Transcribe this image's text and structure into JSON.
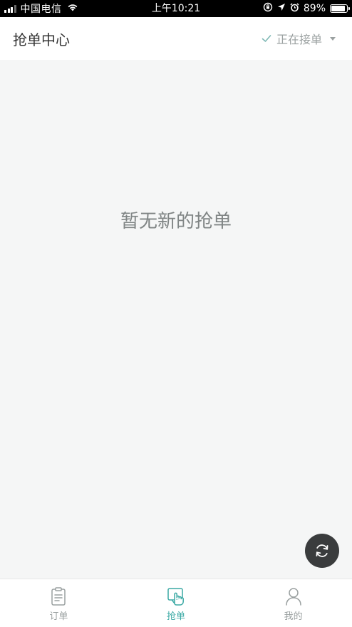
{
  "status_bar": {
    "carrier": "中国电信",
    "time": "上午10:21",
    "battery_percent": "89%",
    "battery_level": 0.89,
    "icons": [
      "signal-icon",
      "wifi-icon",
      "lock-rotation-icon",
      "location-icon",
      "alarm-icon",
      "battery-icon"
    ]
  },
  "header": {
    "title": "抢单中心",
    "status_label": "正在接单",
    "icons": [
      "check-icon",
      "caret-down-icon"
    ]
  },
  "main": {
    "empty_message": "暂无新的抢单",
    "fab_icon": "refresh-icon"
  },
  "tabbar": {
    "tabs": [
      {
        "label": "订单",
        "icon": "clipboard-icon",
        "active": false
      },
      {
        "label": "抢单",
        "icon": "tap-hand-icon",
        "active": true
      },
      {
        "label": "我的",
        "icon": "user-icon",
        "active": false
      }
    ]
  },
  "colors": {
    "accent": "#3aa9a4",
    "inactive": "#9aa0a0",
    "background": "#f5f6f6",
    "fab": "#3a3c3d"
  }
}
